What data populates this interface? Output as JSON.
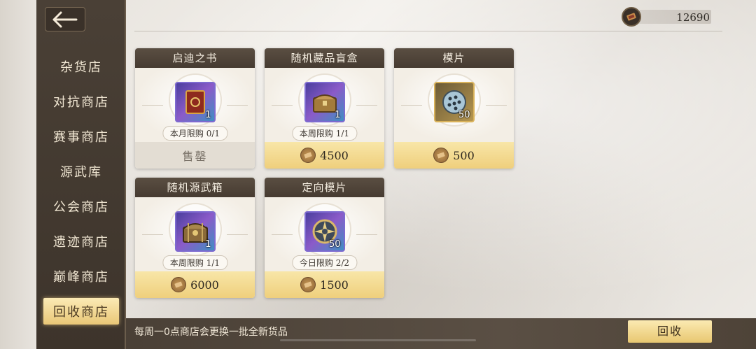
{
  "header": {
    "currency_amount": "12690",
    "currency_icon": "ticket-icon"
  },
  "sidebar": {
    "items": [
      {
        "label": "杂货店"
      },
      {
        "label": "对抗商店"
      },
      {
        "label": "赛事商店"
      },
      {
        "label": "源武库"
      },
      {
        "label": "公会商店"
      },
      {
        "label": "遗迹商店"
      },
      {
        "label": "巅峰商店"
      },
      {
        "label": "回收商店",
        "active": true
      }
    ]
  },
  "shop": {
    "items": [
      {
        "title": "启迪之书",
        "qty": "1",
        "limit": "本月限购 0/1",
        "price": "售罄",
        "sold_out": true,
        "icon": "book-icon"
      },
      {
        "title": "随机藏品盲盒",
        "qty": "1",
        "limit": "本周限购 1/1",
        "price": "4500",
        "icon": "chest-icon"
      },
      {
        "title": "模片",
        "qty": "50",
        "limit": "",
        "price": "500",
        "icon": "disc-icon"
      },
      {
        "title": "随机源武箱",
        "qty": "1",
        "limit": "本周限购 1/1",
        "price": "6000",
        "icon": "weapon-chest-icon"
      },
      {
        "title": "定向模片",
        "qty": "50",
        "limit": "今日限购 2/2",
        "price": "1500",
        "icon": "compass-disc-icon"
      }
    ]
  },
  "footer": {
    "notice": "每周一0点商店会更换一批全新货品",
    "recycle_label": "回收"
  },
  "colors": {
    "sidebar_bg": "#3d342b",
    "active_tab": "#e9c777",
    "price_bar": "#efcf7c"
  }
}
